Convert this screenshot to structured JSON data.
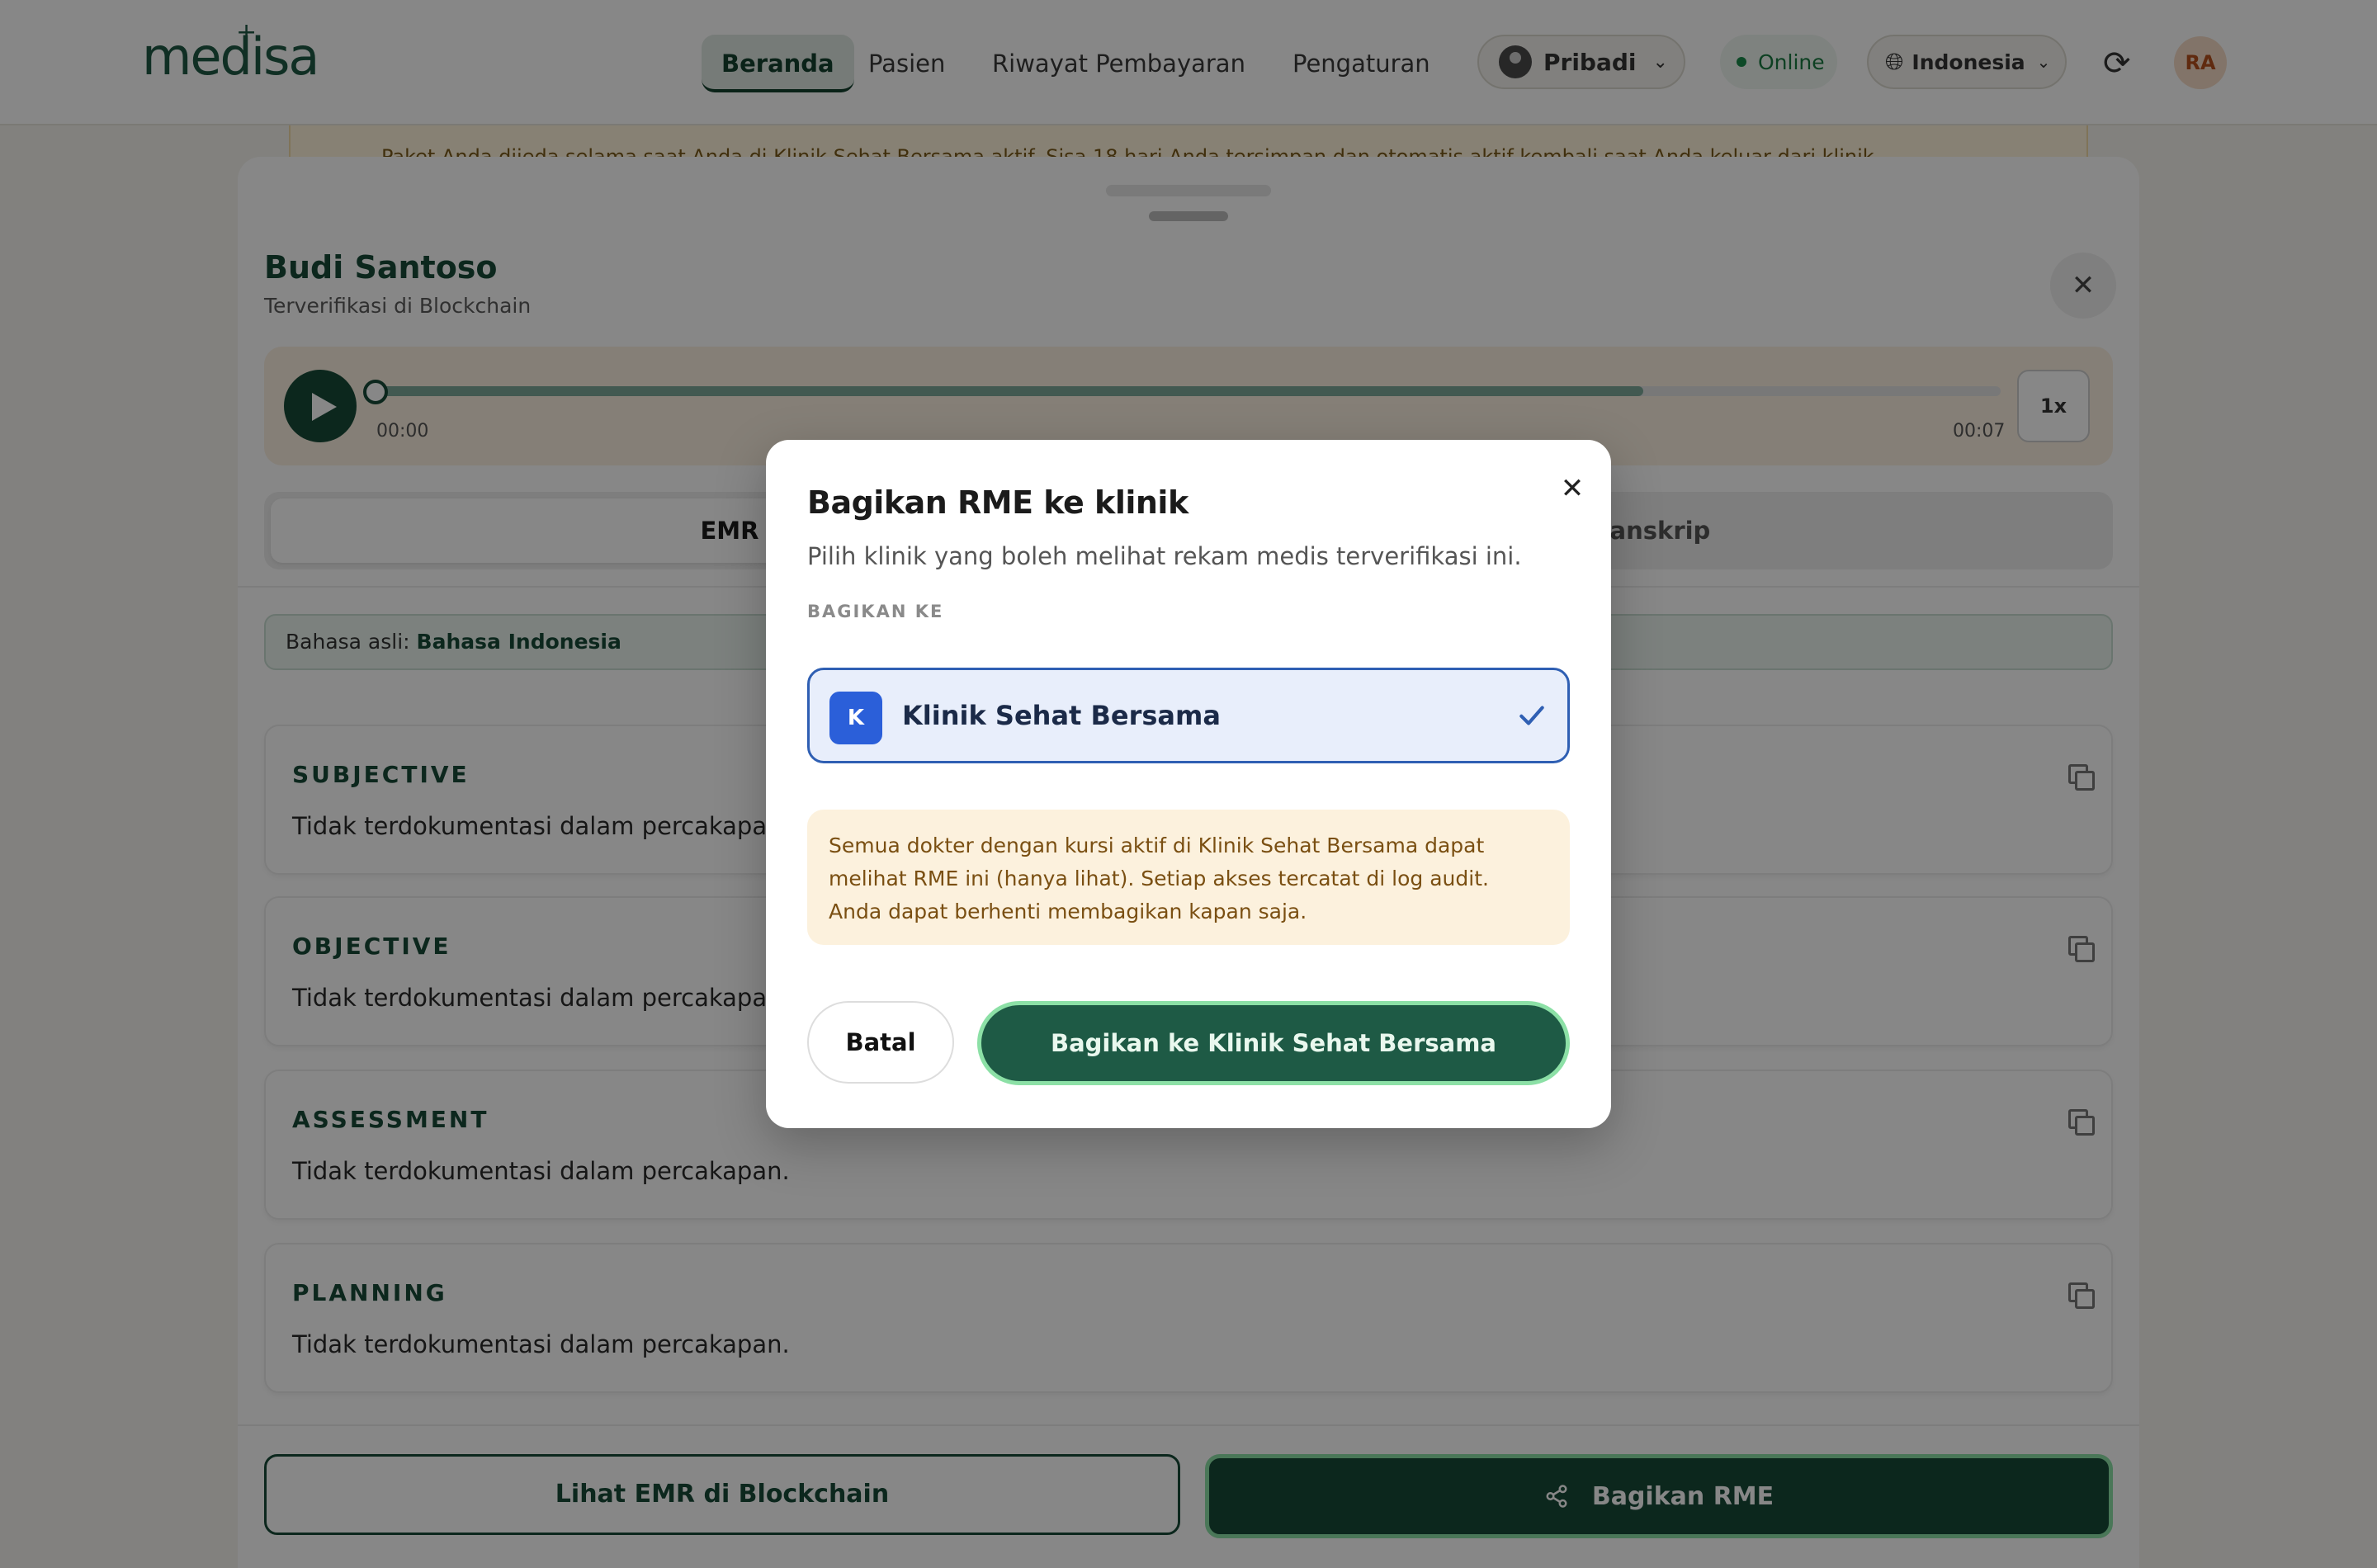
{
  "app": {
    "logo": "medisa"
  },
  "nav": {
    "items": [
      {
        "label": "Beranda"
      },
      {
        "label": "Pasien"
      },
      {
        "label": "Riwayat Pembayaran"
      },
      {
        "label": "Pengaturan"
      }
    ],
    "account": "Pribadi",
    "status": "Online",
    "language": "Indonesia",
    "user_initials": "RA"
  },
  "background_notice": "Paket Anda dijeda selama saat Anda di Klinik Sehat Bersama aktif. Sisa 18 hari Anda tersimpan dan otomatis aktif kembali saat Anda keluar dari klinik",
  "sheet": {
    "patient_name": "Budi Santoso",
    "patient_subtitle": "Terverifikasi di Blockchain",
    "player": {
      "current": "00:00",
      "duration": "00:07",
      "speed": "1x",
      "progress": 0.0,
      "buffered": 0.78
    },
    "tabs": [
      {
        "label": "EMR",
        "active": true
      },
      {
        "label": "Transkrip",
        "active": false
      }
    ],
    "language_prefix": "Bahasa asli: ",
    "language_value": "Bahasa Indonesia",
    "sections": [
      {
        "title": "SUBJECTIVE",
        "body": "Tidak terdokumentasi dalam percakapan."
      },
      {
        "title": "OBJECTIVE",
        "body": "Tidak terdokumentasi dalam percakapan."
      },
      {
        "title": "ASSESSMENT",
        "body": "Tidak terdokumentasi dalam percakapan."
      },
      {
        "title": "PLANNING",
        "body": "Tidak terdokumentasi dalam percakapan."
      }
    ],
    "footer": {
      "view_blockchain": "Lihat EMR di Blockchain",
      "share": "Bagikan RME"
    }
  },
  "modal": {
    "title": "Bagikan RME ke klinik",
    "subtitle": "Pilih klinik yang boleh melihat rekam medis terverifikasi ini.",
    "share_to_label": "BAGIKAN KE",
    "clinic": {
      "initial": "K",
      "name": "Klinik Sehat Bersama",
      "selected": true
    },
    "notice": "Semua dokter dengan kursi aktif di Klinik Sehat Bersama dapat melihat RME ini (hanya lihat). Setiap akses tercatat di log audit. Anda dapat berhenti membagikan kapan saja.",
    "cancel": "Batal",
    "confirm": "Bagikan ke Klinik Sehat Bersama"
  },
  "colors": {
    "brand_green": "#174a38",
    "accent_green_border": "#8ce0a6",
    "clinic_blue": "#2b5fd9",
    "notice_bg": "#fcf1dd"
  }
}
